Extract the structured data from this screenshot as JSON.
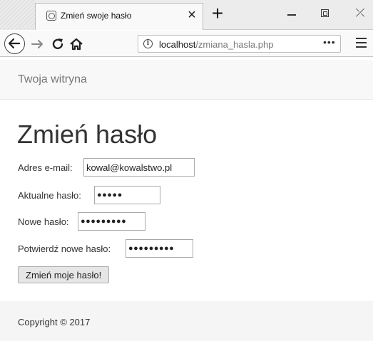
{
  "browser": {
    "tab": {
      "title": "Zmień swoje hasło",
      "close_glyph": "×",
      "favicon": "page-icon"
    },
    "new_tab_glyph": "+",
    "window_controls": {
      "close_glyph": "⤫"
    },
    "url": {
      "host": "localhost",
      "path": "/zmiana_hasla.php",
      "menu_glyph": "•••"
    }
  },
  "site": {
    "brand": "Twoja witryna"
  },
  "page": {
    "title": "Zmień hasło"
  },
  "form": {
    "email": {
      "label": "Adres e-mail:",
      "value": "kowal@kowalstwo.pl"
    },
    "current_password": {
      "label": "Aktualne hasło:",
      "value": "●●●●●"
    },
    "new_password": {
      "label": "Nowe hasło:",
      "value": "●●●●●●●●●"
    },
    "confirm_password": {
      "label": "Potwierdź nowe hasło:",
      "value": "●●●●●●●●●"
    },
    "submit_label": "Zmień moje hasło!"
  },
  "footer": {
    "copyright": "Copyright © 2017"
  }
}
